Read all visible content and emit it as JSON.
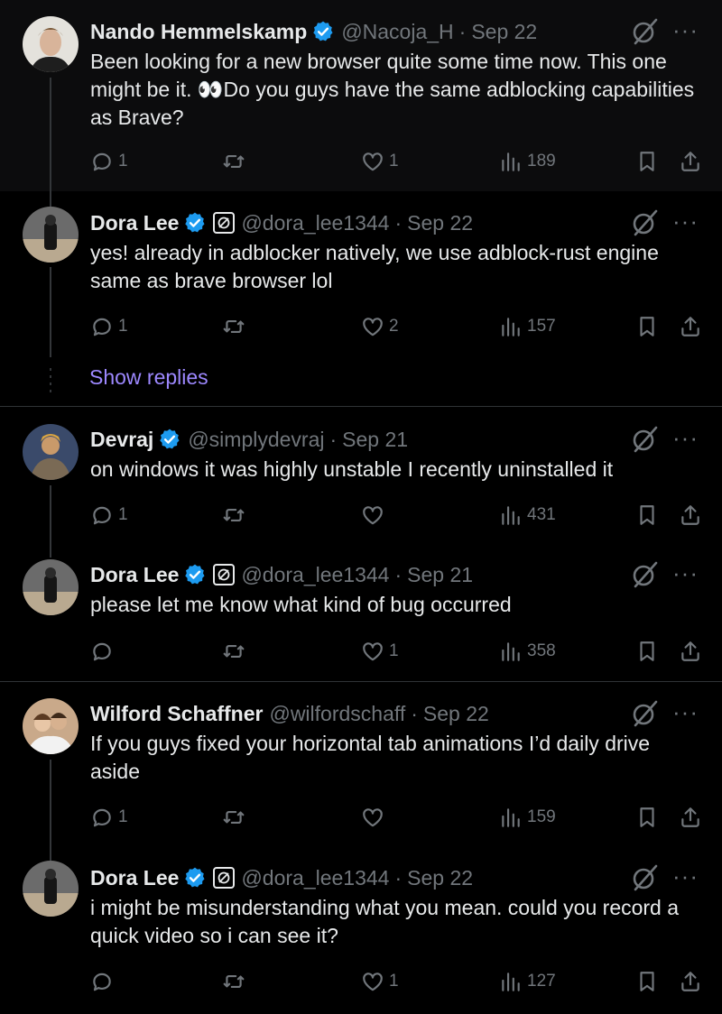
{
  "tweets": [
    {
      "name": "Nando Hemmelskamp",
      "handle": "@Nacoja_H",
      "separator": "·",
      "date": "Sep 22",
      "verified": true,
      "affiliate": false,
      "text": "Been looking for a new browser quite some time now. This one might be it. 👀Do you guys have the same adblocking capabilities as Brave?",
      "replies": "1",
      "retweets": "",
      "likes": "1",
      "views": "189"
    },
    {
      "name": "Dora Lee",
      "handle": "@dora_lee1344",
      "separator": "·",
      "date": "Sep 22",
      "verified": true,
      "affiliate": true,
      "text": "yes! already in adblocker natively, we use adblock-rust engine same as brave browser lol",
      "replies": "1",
      "retweets": "",
      "likes": "2",
      "views": "157"
    },
    {
      "name": "Devraj",
      "handle": "@simplydevraj",
      "separator": "·",
      "date": "Sep 21",
      "verified": true,
      "affiliate": false,
      "text": "on windows it was highly unstable I recently uninstalled it",
      "replies": "1",
      "retweets": "",
      "likes": "",
      "views": "431"
    },
    {
      "name": "Dora Lee",
      "handle": "@dora_lee1344",
      "separator": "·",
      "date": "Sep 21",
      "verified": true,
      "affiliate": true,
      "text": "please let me know what kind of bug occurred",
      "replies": "",
      "retweets": "",
      "likes": "1",
      "views": "358"
    },
    {
      "name": "Wilford Schaffner",
      "handle": "@wilfordschaff",
      "separator": "·",
      "date": "Sep 22",
      "verified": false,
      "affiliate": false,
      "text": "If you guys fixed your horizontal tab animations I’d daily drive aside",
      "replies": "1",
      "retweets": "",
      "likes": "",
      "views": "159"
    },
    {
      "name": "Dora Lee",
      "handle": "@dora_lee1344",
      "separator": "·",
      "date": "Sep 22",
      "verified": true,
      "affiliate": true,
      "text": "i might be misunderstanding what you mean. could you record a quick video so i can see it?",
      "replies": "",
      "retweets": "",
      "likes": "1",
      "views": "127"
    }
  ],
  "show_replies_label": "Show replies",
  "more_label": "···",
  "colors": {
    "background": "#000000",
    "highlight_background": "#0c0c0d",
    "text": "#e7e9ea",
    "muted": "#71767b",
    "verified_blue": "#1d9bf0",
    "show_replies": "#9d88ff",
    "divider": "#2f3336"
  }
}
